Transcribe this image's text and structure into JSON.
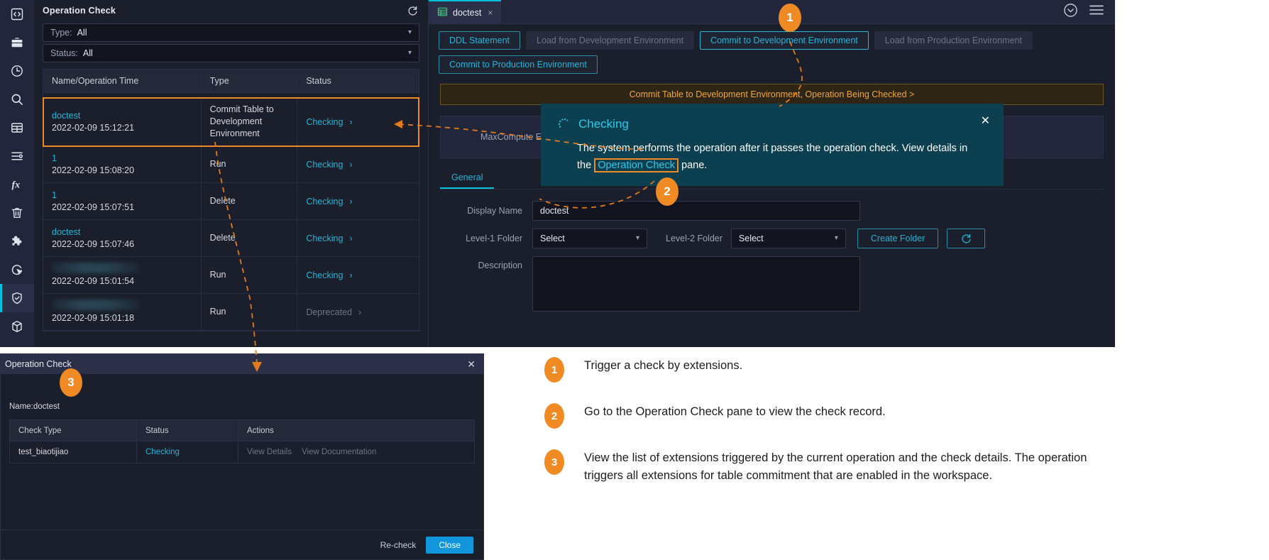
{
  "rail": {
    "items": [
      {
        "name": "code-icon",
        "active": false
      },
      {
        "name": "briefcase-icon",
        "active": false
      },
      {
        "name": "clock-icon",
        "active": false
      },
      {
        "name": "search-icon",
        "active": false
      },
      {
        "name": "table-icon",
        "active": false
      },
      {
        "name": "list-settings-icon",
        "active": false
      },
      {
        "name": "function-fx-icon",
        "active": false
      },
      {
        "name": "trash-icon",
        "active": false
      },
      {
        "name": "puzzle-icon",
        "active": false
      },
      {
        "name": "cursor-refresh-icon",
        "active": false
      },
      {
        "name": "shield-check-icon",
        "active": true
      },
      {
        "name": "cube-icon",
        "active": false
      }
    ]
  },
  "left_panel": {
    "title": "Operation Check",
    "refresh_icon": "refresh-icon",
    "filters": [
      {
        "label": "Type:",
        "value": "All"
      },
      {
        "label": "Status:",
        "value": "All"
      }
    ],
    "columns": [
      "Name/Operation Time",
      "Type",
      "Status"
    ],
    "rows": [
      {
        "name": "doctest",
        "blurred": false,
        "time": "2022-02-09 15:12:21",
        "type": "Commit Table to Development Environment",
        "status": "Checking",
        "highlighted": true
      },
      {
        "name": "1",
        "blurred": false,
        "time": "2022-02-09 15:08:20",
        "type": "Run",
        "status": "Checking",
        "highlighted": false
      },
      {
        "name": "1",
        "blurred": false,
        "time": "2022-02-09 15:07:51",
        "type": "Delete",
        "status": "Checking",
        "highlighted": false
      },
      {
        "name": "doctest",
        "blurred": false,
        "time": "2022-02-09 15:07:46",
        "type": "Delete",
        "status": "Checking",
        "highlighted": false
      },
      {
        "name": "",
        "blurred": true,
        "time": "2022-02-09 15:01:54",
        "type": "Run",
        "status": "Checking",
        "highlighted": false
      },
      {
        "name": "",
        "blurred": true,
        "time": "2022-02-09 15:01:18",
        "type": "Run",
        "status": "Deprecated",
        "highlighted": false
      }
    ]
  },
  "main": {
    "tab": {
      "label": "doctest",
      "icon": "table-grid-icon",
      "close": "×"
    },
    "tabbar_right": [
      {
        "name": "collapse-down-icon"
      },
      {
        "name": "menu-hamburger-icon"
      }
    ],
    "buttons": [
      {
        "label": "DDL Statement",
        "state": "enabled"
      },
      {
        "label": "Load from Development Environment",
        "state": "disabled"
      },
      {
        "label": "Commit to Development Environment",
        "state": "focused"
      },
      {
        "label": "Load from Production Environment",
        "state": "disabled"
      },
      {
        "label": "Commit to Production Environment",
        "state": "enabled"
      }
    ],
    "banner": "Commit Table to Development Environment, Operation Being Checked >",
    "subcard_label": "MaxCompute En",
    "tabs2": [
      {
        "label": "General",
        "active": true
      }
    ],
    "form": {
      "display_name_label": "Display Name",
      "display_name_value": "doctest",
      "level1_label": "Level-1 Folder",
      "level1_value": "Select",
      "level2_label": "Level-2 Folder",
      "level2_value": "Select",
      "create_folder_label": "Create Folder",
      "refresh_icon": "refresh-icon",
      "description_label": "Description",
      "description_value": ""
    }
  },
  "toast": {
    "icon": "loading-spinner-icon",
    "title": "Checking",
    "body_pre": "The system performs the operation after it passes the operation check. View details in the ",
    "body_link": "Operation Check",
    "body_post": " pane.",
    "close": "✕"
  },
  "modal": {
    "title": "Operation Check",
    "close": "✕",
    "name_line": "Name:doctest",
    "columns": [
      "Check Type",
      "Status",
      "Actions"
    ],
    "rows": [
      {
        "check_type": "test_biaotijiao",
        "status": "Checking",
        "actions": [
          "View Details",
          "View Documentation"
        ]
      }
    ],
    "footer": {
      "recheck_label": "Re-check",
      "close_label": "Close"
    }
  },
  "legend": {
    "items": [
      {
        "num": "1",
        "text": "Trigger a check by extensions."
      },
      {
        "num": "2",
        "text": "Go to the Operation Check pane to view the check record."
      },
      {
        "num": "3",
        "text": "View the list of extensions triggered by the current operation and the check details. The operation triggers all extensions for table commitment that are enabled in the workspace."
      }
    ]
  },
  "callouts": [
    {
      "num": "1"
    },
    {
      "num": "2"
    },
    {
      "num": "3"
    }
  ],
  "colors": {
    "accent_orange": "#f08a24",
    "accent_cyan": "#26b4d6",
    "toast_bg": "#0c4050",
    "banner_text": "#f0a73c",
    "primary_button": "#1296db"
  }
}
